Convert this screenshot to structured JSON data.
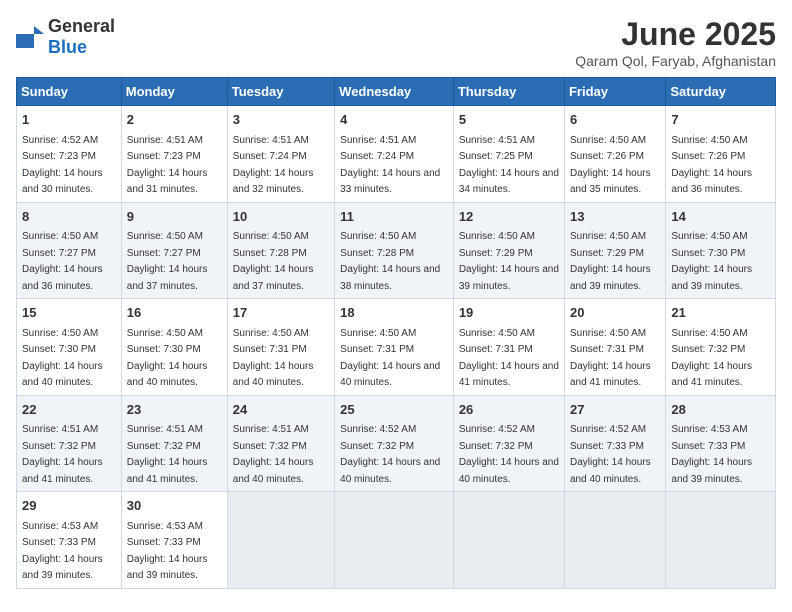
{
  "logo": {
    "text_general": "General",
    "text_blue": "Blue"
  },
  "title": "June 2025",
  "subtitle": "Qaram Qol, Faryab, Afghanistan",
  "days_of_week": [
    "Sunday",
    "Monday",
    "Tuesday",
    "Wednesday",
    "Thursday",
    "Friday",
    "Saturday"
  ],
  "weeks": [
    [
      {
        "day": "1",
        "sunrise": "4:52 AM",
        "sunset": "7:23 PM",
        "daylight": "14 hours and 30 minutes."
      },
      {
        "day": "2",
        "sunrise": "4:51 AM",
        "sunset": "7:23 PM",
        "daylight": "14 hours and 31 minutes."
      },
      {
        "day": "3",
        "sunrise": "4:51 AM",
        "sunset": "7:24 PM",
        "daylight": "14 hours and 32 minutes."
      },
      {
        "day": "4",
        "sunrise": "4:51 AM",
        "sunset": "7:24 PM",
        "daylight": "14 hours and 33 minutes."
      },
      {
        "day": "5",
        "sunrise": "4:51 AM",
        "sunset": "7:25 PM",
        "daylight": "14 hours and 34 minutes."
      },
      {
        "day": "6",
        "sunrise": "4:50 AM",
        "sunset": "7:26 PM",
        "daylight": "14 hours and 35 minutes."
      },
      {
        "day": "7",
        "sunrise": "4:50 AM",
        "sunset": "7:26 PM",
        "daylight": "14 hours and 36 minutes."
      }
    ],
    [
      {
        "day": "8",
        "sunrise": "4:50 AM",
        "sunset": "7:27 PM",
        "daylight": "14 hours and 36 minutes."
      },
      {
        "day": "9",
        "sunrise": "4:50 AM",
        "sunset": "7:27 PM",
        "daylight": "14 hours and 37 minutes."
      },
      {
        "day": "10",
        "sunrise": "4:50 AM",
        "sunset": "7:28 PM",
        "daylight": "14 hours and 37 minutes."
      },
      {
        "day": "11",
        "sunrise": "4:50 AM",
        "sunset": "7:28 PM",
        "daylight": "14 hours and 38 minutes."
      },
      {
        "day": "12",
        "sunrise": "4:50 AM",
        "sunset": "7:29 PM",
        "daylight": "14 hours and 39 minutes."
      },
      {
        "day": "13",
        "sunrise": "4:50 AM",
        "sunset": "7:29 PM",
        "daylight": "14 hours and 39 minutes."
      },
      {
        "day": "14",
        "sunrise": "4:50 AM",
        "sunset": "7:30 PM",
        "daylight": "14 hours and 39 minutes."
      }
    ],
    [
      {
        "day": "15",
        "sunrise": "4:50 AM",
        "sunset": "7:30 PM",
        "daylight": "14 hours and 40 minutes."
      },
      {
        "day": "16",
        "sunrise": "4:50 AM",
        "sunset": "7:30 PM",
        "daylight": "14 hours and 40 minutes."
      },
      {
        "day": "17",
        "sunrise": "4:50 AM",
        "sunset": "7:31 PM",
        "daylight": "14 hours and 40 minutes."
      },
      {
        "day": "18",
        "sunrise": "4:50 AM",
        "sunset": "7:31 PM",
        "daylight": "14 hours and 40 minutes."
      },
      {
        "day": "19",
        "sunrise": "4:50 AM",
        "sunset": "7:31 PM",
        "daylight": "14 hours and 41 minutes."
      },
      {
        "day": "20",
        "sunrise": "4:50 AM",
        "sunset": "7:31 PM",
        "daylight": "14 hours and 41 minutes."
      },
      {
        "day": "21",
        "sunrise": "4:50 AM",
        "sunset": "7:32 PM",
        "daylight": "14 hours and 41 minutes."
      }
    ],
    [
      {
        "day": "22",
        "sunrise": "4:51 AM",
        "sunset": "7:32 PM",
        "daylight": "14 hours and 41 minutes."
      },
      {
        "day": "23",
        "sunrise": "4:51 AM",
        "sunset": "7:32 PM",
        "daylight": "14 hours and 41 minutes."
      },
      {
        "day": "24",
        "sunrise": "4:51 AM",
        "sunset": "7:32 PM",
        "daylight": "14 hours and 40 minutes."
      },
      {
        "day": "25",
        "sunrise": "4:52 AM",
        "sunset": "7:32 PM",
        "daylight": "14 hours and 40 minutes."
      },
      {
        "day": "26",
        "sunrise": "4:52 AM",
        "sunset": "7:32 PM",
        "daylight": "14 hours and 40 minutes."
      },
      {
        "day": "27",
        "sunrise": "4:52 AM",
        "sunset": "7:33 PM",
        "daylight": "14 hours and 40 minutes."
      },
      {
        "day": "28",
        "sunrise": "4:53 AM",
        "sunset": "7:33 PM",
        "daylight": "14 hours and 39 minutes."
      }
    ],
    [
      {
        "day": "29",
        "sunrise": "4:53 AM",
        "sunset": "7:33 PM",
        "daylight": "14 hours and 39 minutes."
      },
      {
        "day": "30",
        "sunrise": "4:53 AM",
        "sunset": "7:33 PM",
        "daylight": "14 hours and 39 minutes."
      },
      null,
      null,
      null,
      null,
      null
    ]
  ]
}
